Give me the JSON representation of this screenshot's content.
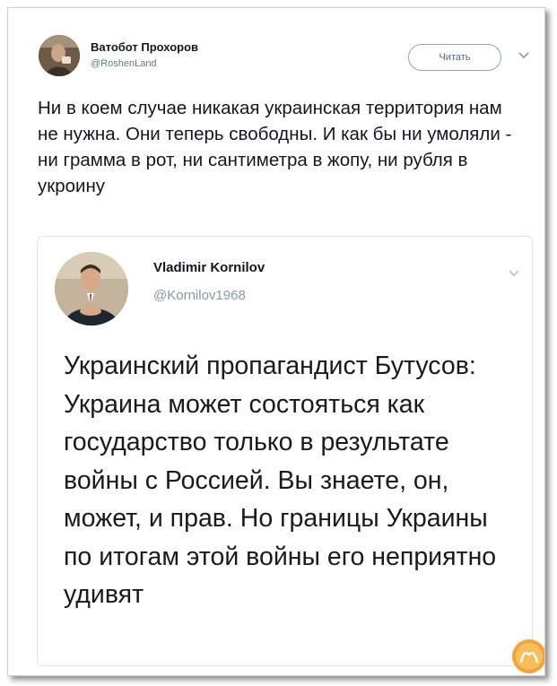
{
  "tweet": {
    "author_name": "Ватобот Прохоров",
    "author_handle": "@RoshenLand",
    "follow_label": "Читать",
    "text": "Ни в коем случае никакая украинская территория нам не нужна. Они теперь свободны. И как бы ни умоляли - ни грамма в рот, ни сантиметра в жопу, ни рубля в укроину"
  },
  "quoted": {
    "author_name": "Vladimir Kornilov",
    "author_handle": "@Kornilov1968",
    "text": "Украинский пропагандист Бутусов: Украина может состояться как государство только в результате войны с Россией. Вы знаете, он, может, и прав. Но границы Украины по итогам этой войны его неприятно удивят"
  },
  "icons": {
    "more_menu": "chevron-down-icon",
    "watermark": "watermark-logo-icon"
  },
  "colors": {
    "text": "#14171a",
    "secondary": "#657786",
    "follow_border": "#8aa4bc",
    "watermark": "#f2a33a"
  }
}
